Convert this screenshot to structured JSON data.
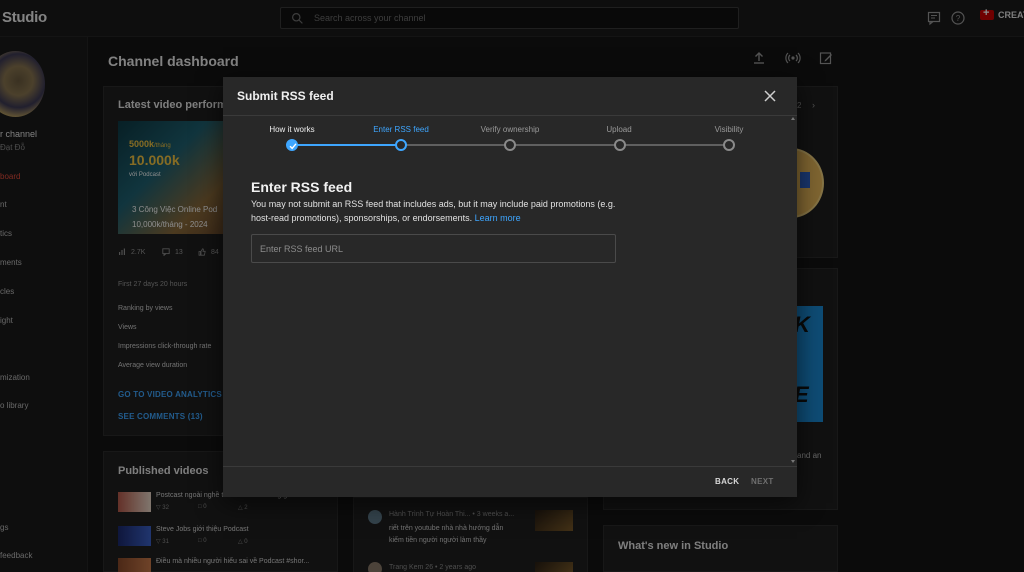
{
  "app": {
    "studio_label": "Studio",
    "create_label": "CREAT"
  },
  "search": {
    "placeholder": "Search across your channel"
  },
  "sidebar": {
    "channel_name": "r channel",
    "channel_owner": "Đạt Đỗ",
    "items": [
      {
        "label": "board"
      },
      {
        "label": "nt"
      },
      {
        "label": "tics"
      },
      {
        "label": "ments"
      },
      {
        "label": "cles"
      },
      {
        "label": "ight"
      },
      {
        "label": "mization"
      },
      {
        "label": "o library"
      },
      {
        "label": "gs"
      },
      {
        "label": "feedback"
      }
    ]
  },
  "dashboard": {
    "title": "Channel dashboard",
    "latest_card": {
      "title": "Latest video performa",
      "thumb_line1": "5000k",
      "thumb_line1_small": "/tháng",
      "thumb_line2": "10.000k",
      "thumb_line3": "với Podcast",
      "thumb_line4": "3 Công Việc Online Pod",
      "thumb_line5": "10,000k/tháng - 2024",
      "stat_views": "2.7K",
      "stat_comments": "13",
      "stat_likes": "84",
      "first_period": "First 27 days 20 hours",
      "rows": [
        "Ranking by views",
        "Views",
        "Impressions click-through rate",
        "Average view duration"
      ],
      "link_analytics": "GO TO VIDEO ANALYTICS",
      "link_comments": "SEE COMMENTS (13)"
    },
    "published_card": {
      "title": "Published videos",
      "videos": [
        {
          "title": "Postcast ngoài nghề thì có có trình năng gì nhất",
          "views": "32",
          "comments": "0",
          "likes": "2"
        },
        {
          "title": "Steve Jobs giới thiệu Podcast",
          "views": "31",
          "comments": "0",
          "likes": "0"
        },
        {
          "title": "Điều mà nhiều người hiểu sai về Podcast #shor..."
        }
      ]
    },
    "comments_card": {
      "items": [
        {
          "meta": "Hành Trình Tự Hoàn Thi... • 3 weeks a...",
          "text1": "riết  trên youtube nhà nhà hướng dẫn",
          "text2": "kiếm tiền người người làm thầy"
        },
        {
          "meta": "Trang Kem 26 • 2 years ago"
        }
      ]
    },
    "right_card": {
      "page_indicator": "2",
      "text_snippet": "and an"
    },
    "whats_new": {
      "title": "What's new in Studio"
    }
  },
  "dialog": {
    "title": "Submit RSS feed",
    "steps": [
      {
        "label": "How it works",
        "state": "done"
      },
      {
        "label": "Enter RSS feed",
        "state": "active"
      },
      {
        "label": "Verify ownership",
        "state": "todo"
      },
      {
        "label": "Upload",
        "state": "todo"
      },
      {
        "label": "Visibility",
        "state": "todo"
      }
    ],
    "heading": "Enter RSS feed",
    "description": "You may not submit an RSS feed that includes ads, but it may include paid promotions (e.g. host-read promotions), sponsorships, or endorsements.",
    "learn_more": "Learn more",
    "input_placeholder": "Enter RSS feed URL",
    "input_value": "",
    "back_label": "BACK",
    "next_label": "NEXT"
  },
  "colors": {
    "accent": "#3ea6ff",
    "danger": "#e74c3c",
    "dialog_bg": "#282828",
    "page_bg": "#141414"
  }
}
